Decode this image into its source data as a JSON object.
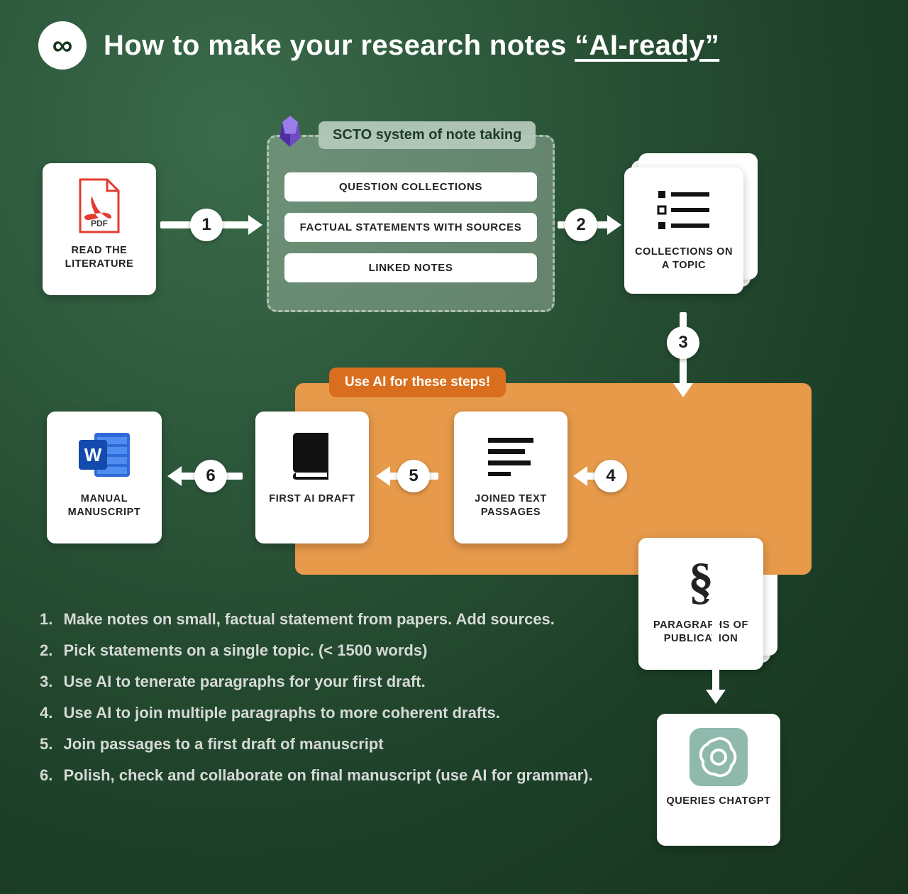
{
  "header": {
    "logo_glyph": "∞",
    "title_prefix": "How to make your research notes ",
    "title_quoted": "“AI-ready”"
  },
  "scto": {
    "title": "SCTO system of note taking",
    "pill1": "QUESTION COLLECTIONS",
    "pill2": "FACTUAL STATEMENTS WITH SOURCES",
    "pill3": "LINKED NOTES"
  },
  "cards": {
    "read": "READ THE LITERATURE",
    "collections": "COLLECTIONS ON A TOPIC",
    "paragraphs": "PARAGRAPHS OF PUBLICATION",
    "joined": "JOINED TEXT PASSAGES",
    "first_ai": "FIRST AI DRAFT",
    "manual": "MANUAL MANUSCRIPT",
    "chatgpt": "QUERIES CHATGPT"
  },
  "ai_badge": "Use AI for these steps!",
  "arrows": {
    "n1": "1",
    "n2": "2",
    "n3": "3",
    "n4": "4",
    "n5": "5",
    "n6": "6"
  },
  "steps": [
    "Make notes on small, factual statement from papers. Add sources.",
    "Pick statements on a single topic. (< 1500 words)",
    "Use AI to tenerate paragraphs for your first draft.",
    "Use AI to join multiple paragraphs to more coherent drafts.",
    "Join passages to a first draft of manuscript",
    "Polish, check and collaborate on final manuscript (use AI for grammar)."
  ],
  "colors": {
    "accent_orange": "#e79a4a",
    "accent_orange_dark": "#d96f1e"
  }
}
